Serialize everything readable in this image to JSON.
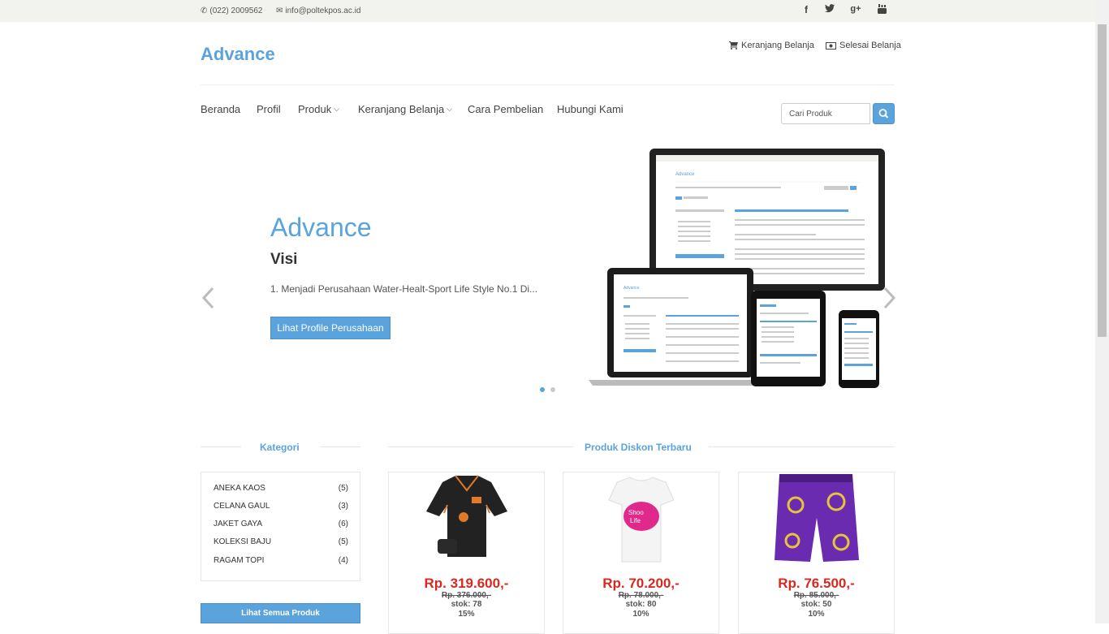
{
  "topbar": {
    "phone": "(022) 2009562",
    "email": "info@poltekpos.ac.id",
    "social": [
      {
        "icon": "facebook-icon",
        "glyph": "f"
      },
      {
        "icon": "twitter-icon",
        "glyph": "t"
      },
      {
        "icon": "google-plus-icon",
        "glyph": "g+"
      },
      {
        "icon": "youtube-icon",
        "glyph": "yt"
      }
    ]
  },
  "header": {
    "brand": "Advance",
    "cart_link": "Keranjang Belanja",
    "checkout_link": "Selesai Belanja"
  },
  "nav": {
    "items": [
      "Beranda",
      "Profil",
      "Produk",
      "Keranjang Belanja",
      "Cara Pembelian",
      "Hubungi Kami"
    ],
    "search_placeholder": "Cari Produk"
  },
  "slider": {
    "title": "Advance",
    "subtitle": "Visi",
    "text": "1. Menjadi Perusahaan Water-Healt-Sport Life Style No.1 Di...",
    "button": "Lihat Profile Perusahaan",
    "mockup_brand": "Advance"
  },
  "kategori": {
    "title": "Kategori",
    "items": [
      {
        "name": "ANEKA KAOS",
        "count": "(5)"
      },
      {
        "name": "CELANA GAUL",
        "count": "(3)"
      },
      {
        "name": "JAKET GAYA",
        "count": "(6)"
      },
      {
        "name": "KOLEKSI BAJU",
        "count": "(5)"
      },
      {
        "name": "RAGAM TOPI",
        "count": "(4)"
      }
    ],
    "button": "Lihat Semua Produk"
  },
  "produk": {
    "title": "Produk Diskon Terbaru",
    "items": [
      {
        "price": "Rp. 319.600,-",
        "old": "Rp. 376.000,-",
        "stok": "stok: 78",
        "disc": "15%"
      },
      {
        "price": "Rp. 70.200,-",
        "old": "Rp. 78.000,-",
        "stok": "stok: 80",
        "disc": "10%"
      },
      {
        "price": "Rp. 76.500,-",
        "old": "Rp. 85.000,-",
        "stok": "stok: 50",
        "disc": "10%"
      }
    ]
  },
  "colors": {
    "accent": "#5aa3dd",
    "price": "#d9281f"
  }
}
